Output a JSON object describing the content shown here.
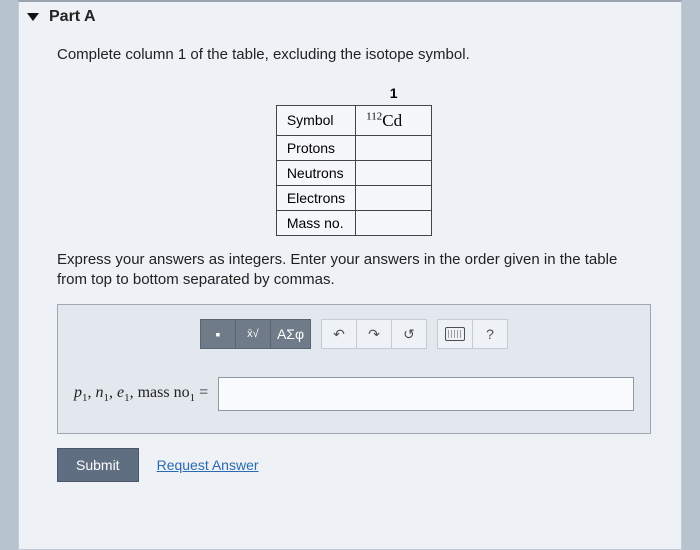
{
  "part": {
    "label": "Part A"
  },
  "instruction1": "Complete column 1 of the table, excluding the isotope symbol.",
  "table": {
    "col_header": "1",
    "rows": [
      {
        "label": "Symbol",
        "value_sup": "112",
        "value_elem": "Cd"
      },
      {
        "label": "Protons",
        "value": ""
      },
      {
        "label": "Neutrons",
        "value": ""
      },
      {
        "label": "Electrons",
        "value": ""
      },
      {
        "label": "Mass no.",
        "value": ""
      }
    ]
  },
  "instruction2": "Express your answers as integers. Enter your answers in the order given in the table from top to bottom separated by commas.",
  "toolbar": {
    "templates_icon": "■",
    "fraction_icon": "x√",
    "greek": "ΑΣφ",
    "undo": "↶",
    "redo": "↷",
    "reset": "↺",
    "keyboard": "kbd",
    "help": "?"
  },
  "answer": {
    "lhs_p": "p",
    "lhs_n": "n",
    "lhs_e": "e",
    "lhs_mass": "mass no",
    "sub": "1",
    "eq": "=",
    "value": ""
  },
  "actions": {
    "submit": "Submit",
    "request": "Request Answer"
  }
}
